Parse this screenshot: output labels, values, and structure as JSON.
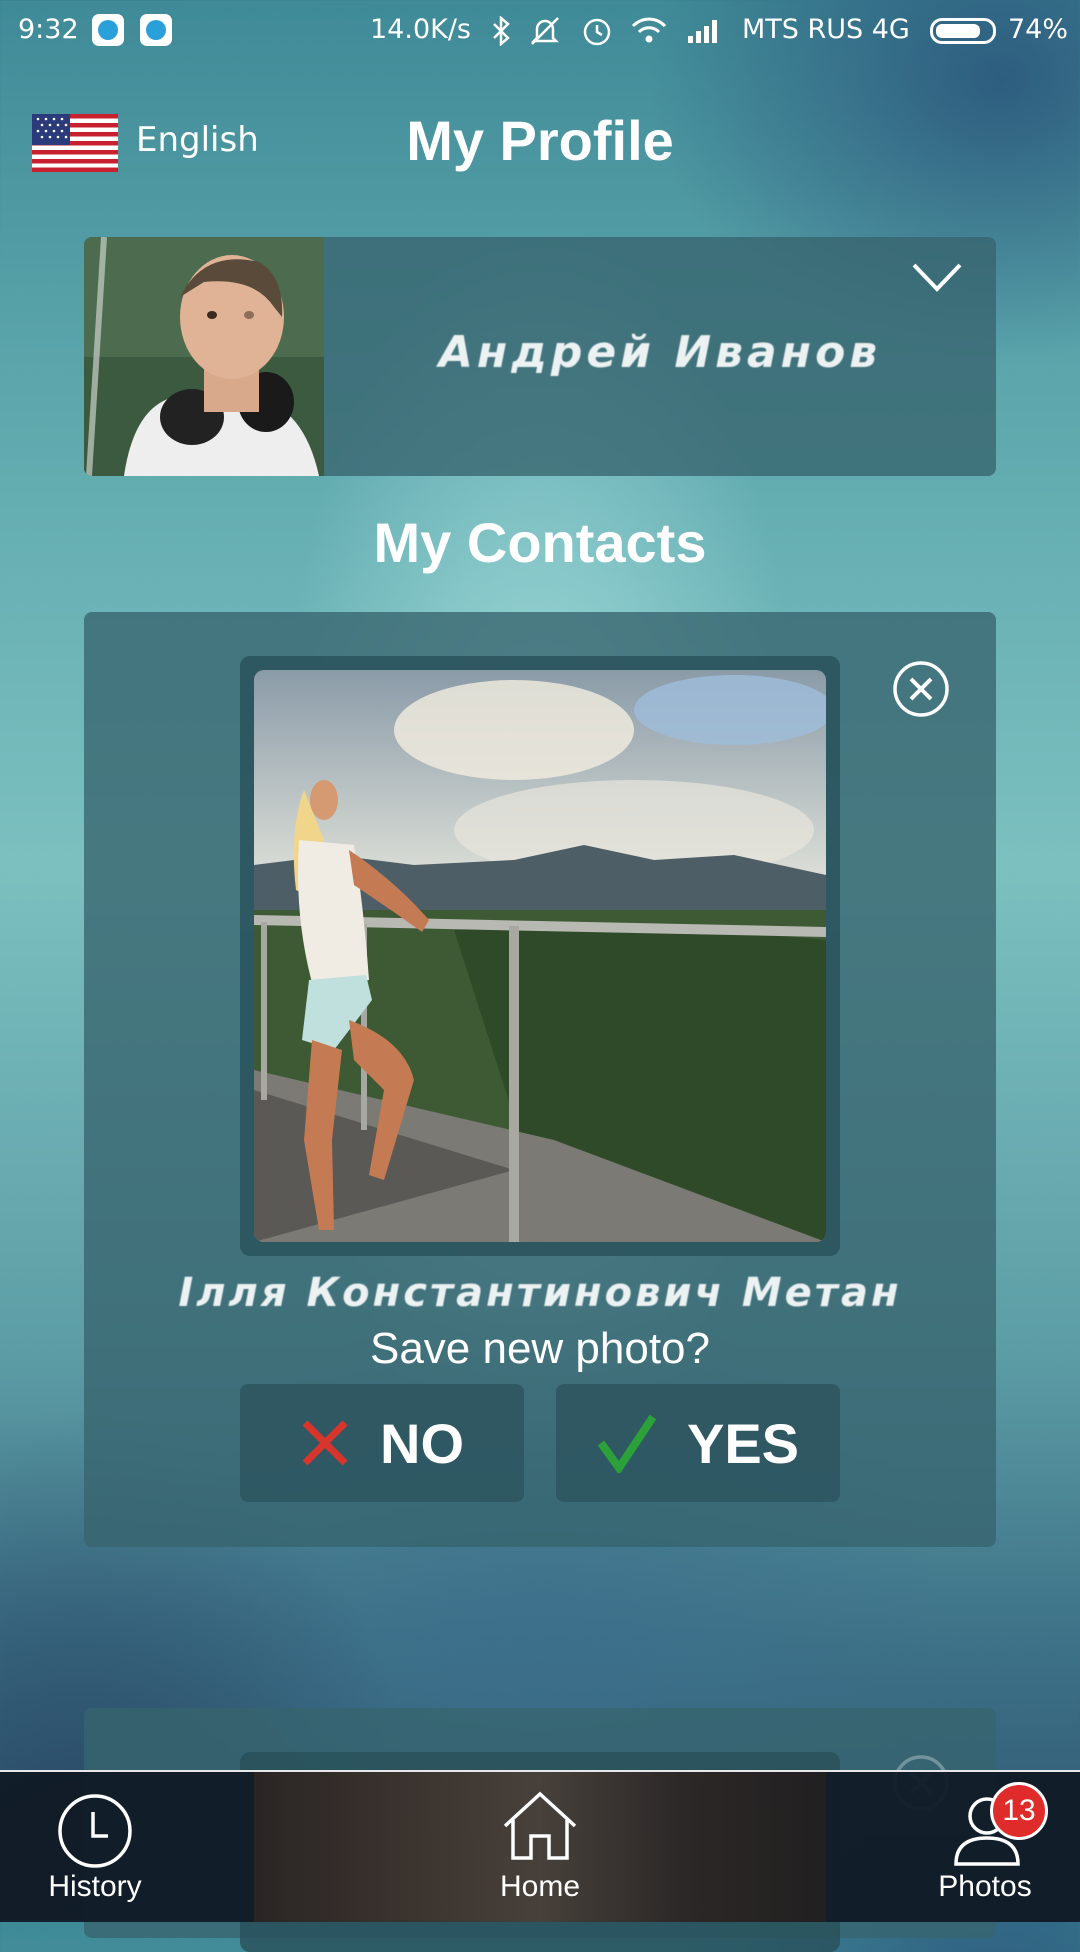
{
  "status_bar": {
    "time": "9:32",
    "net_speed": "14.0K/s",
    "carrier": "MTS RUS 4G",
    "battery": "74%",
    "battery_level": 0.74,
    "icons": [
      "telegram-icon",
      "telegram-icon",
      "bluetooth-icon",
      "mute-icon",
      "alarm-icon",
      "wifi-icon",
      "signal-icon"
    ]
  },
  "header": {
    "language": "English",
    "title": "My Profile"
  },
  "profile": {
    "name": "Андрей Иванов"
  },
  "contacts": {
    "title": "My Contacts",
    "card": {
      "name": "Ілля Константинович Метан",
      "prompt": "Save new photo?",
      "no_label": "NO",
      "yes_label": "YES"
    }
  },
  "nav": {
    "history_label": "History",
    "home_label": "Home",
    "photos_label": "Photos",
    "photos_badge": "13"
  },
  "colors": {
    "no_red": "#d8352c",
    "yes_green": "#2ca13a",
    "badge_red": "#e02b2b"
  }
}
